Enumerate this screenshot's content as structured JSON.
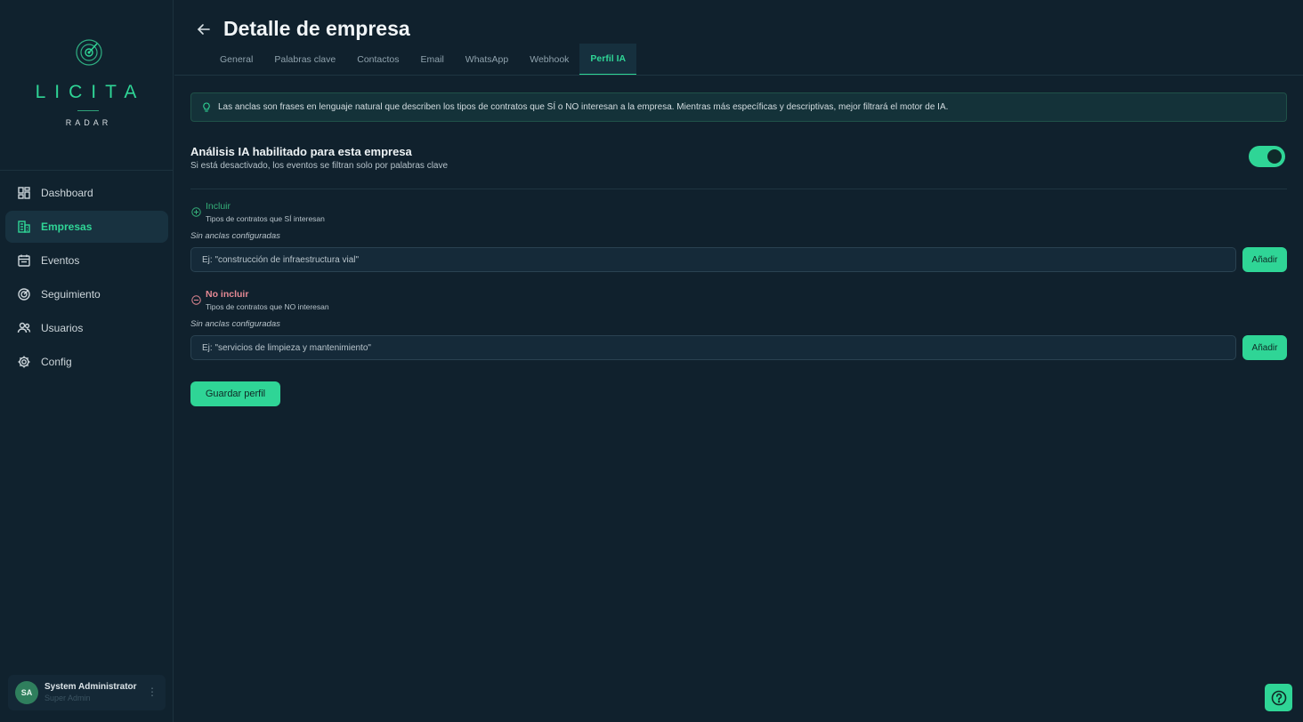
{
  "brand": {
    "name": "LICITA",
    "sub": "RADAR",
    "accent": "#2fd596"
  },
  "sidebar": {
    "items": [
      {
        "label": "Dashboard",
        "icon": "dashboard-icon",
        "active": false
      },
      {
        "label": "Empresas",
        "icon": "building-icon",
        "active": true
      },
      {
        "label": "Eventos",
        "icon": "calendar-icon",
        "active": false
      },
      {
        "label": "Seguimiento",
        "icon": "radar-icon",
        "active": false
      },
      {
        "label": "Usuarios",
        "icon": "users-icon",
        "active": false
      },
      {
        "label": "Config",
        "icon": "gear-icon",
        "active": false
      }
    ],
    "user": {
      "initials": "SA",
      "name": "System Administrator",
      "role": "Super Admin",
      "menu": "⋮"
    }
  },
  "header": {
    "title": "Detalle de empresa",
    "tabs": [
      {
        "label": "General",
        "active": false
      },
      {
        "label": "Palabras clave",
        "active": false
      },
      {
        "label": "Contactos",
        "active": false
      },
      {
        "label": "Email",
        "active": false
      },
      {
        "label": "WhatsApp",
        "active": false
      },
      {
        "label": "Webhook",
        "active": false
      },
      {
        "label": "Perfil IA",
        "active": true
      }
    ]
  },
  "main": {
    "banner": "Las anclas son frases en lenguaje natural que describen los tipos de contratos que SÍ o NO interesan a la empresa. Mientras más específicas y descriptivas, mejor filtrará el motor de IA.",
    "ai_toggle": {
      "title": "Análisis IA habilitado para esta empresa",
      "subtitle": "Si está desactivado, los eventos se filtran solo por palabras clave",
      "enabled": true
    },
    "include": {
      "title": "Incluir",
      "subtitle": "Tipos de contratos que SÍ interesan",
      "empty": "Sin anclas configuradas",
      "placeholder": "Ej: \"construcción de infraestructura vial\"",
      "add_label": "Añadir",
      "color": "#35b079"
    },
    "exclude": {
      "title": "No incluir",
      "subtitle": "Tipos de contratos que NO interesan",
      "empty": "Sin anclas configuradas",
      "placeholder": "Ej: \"servicios de limpieza y mantenimiento\"",
      "add_label": "Añadir",
      "color": "#e58994"
    },
    "save_label": "Guardar perfil"
  }
}
